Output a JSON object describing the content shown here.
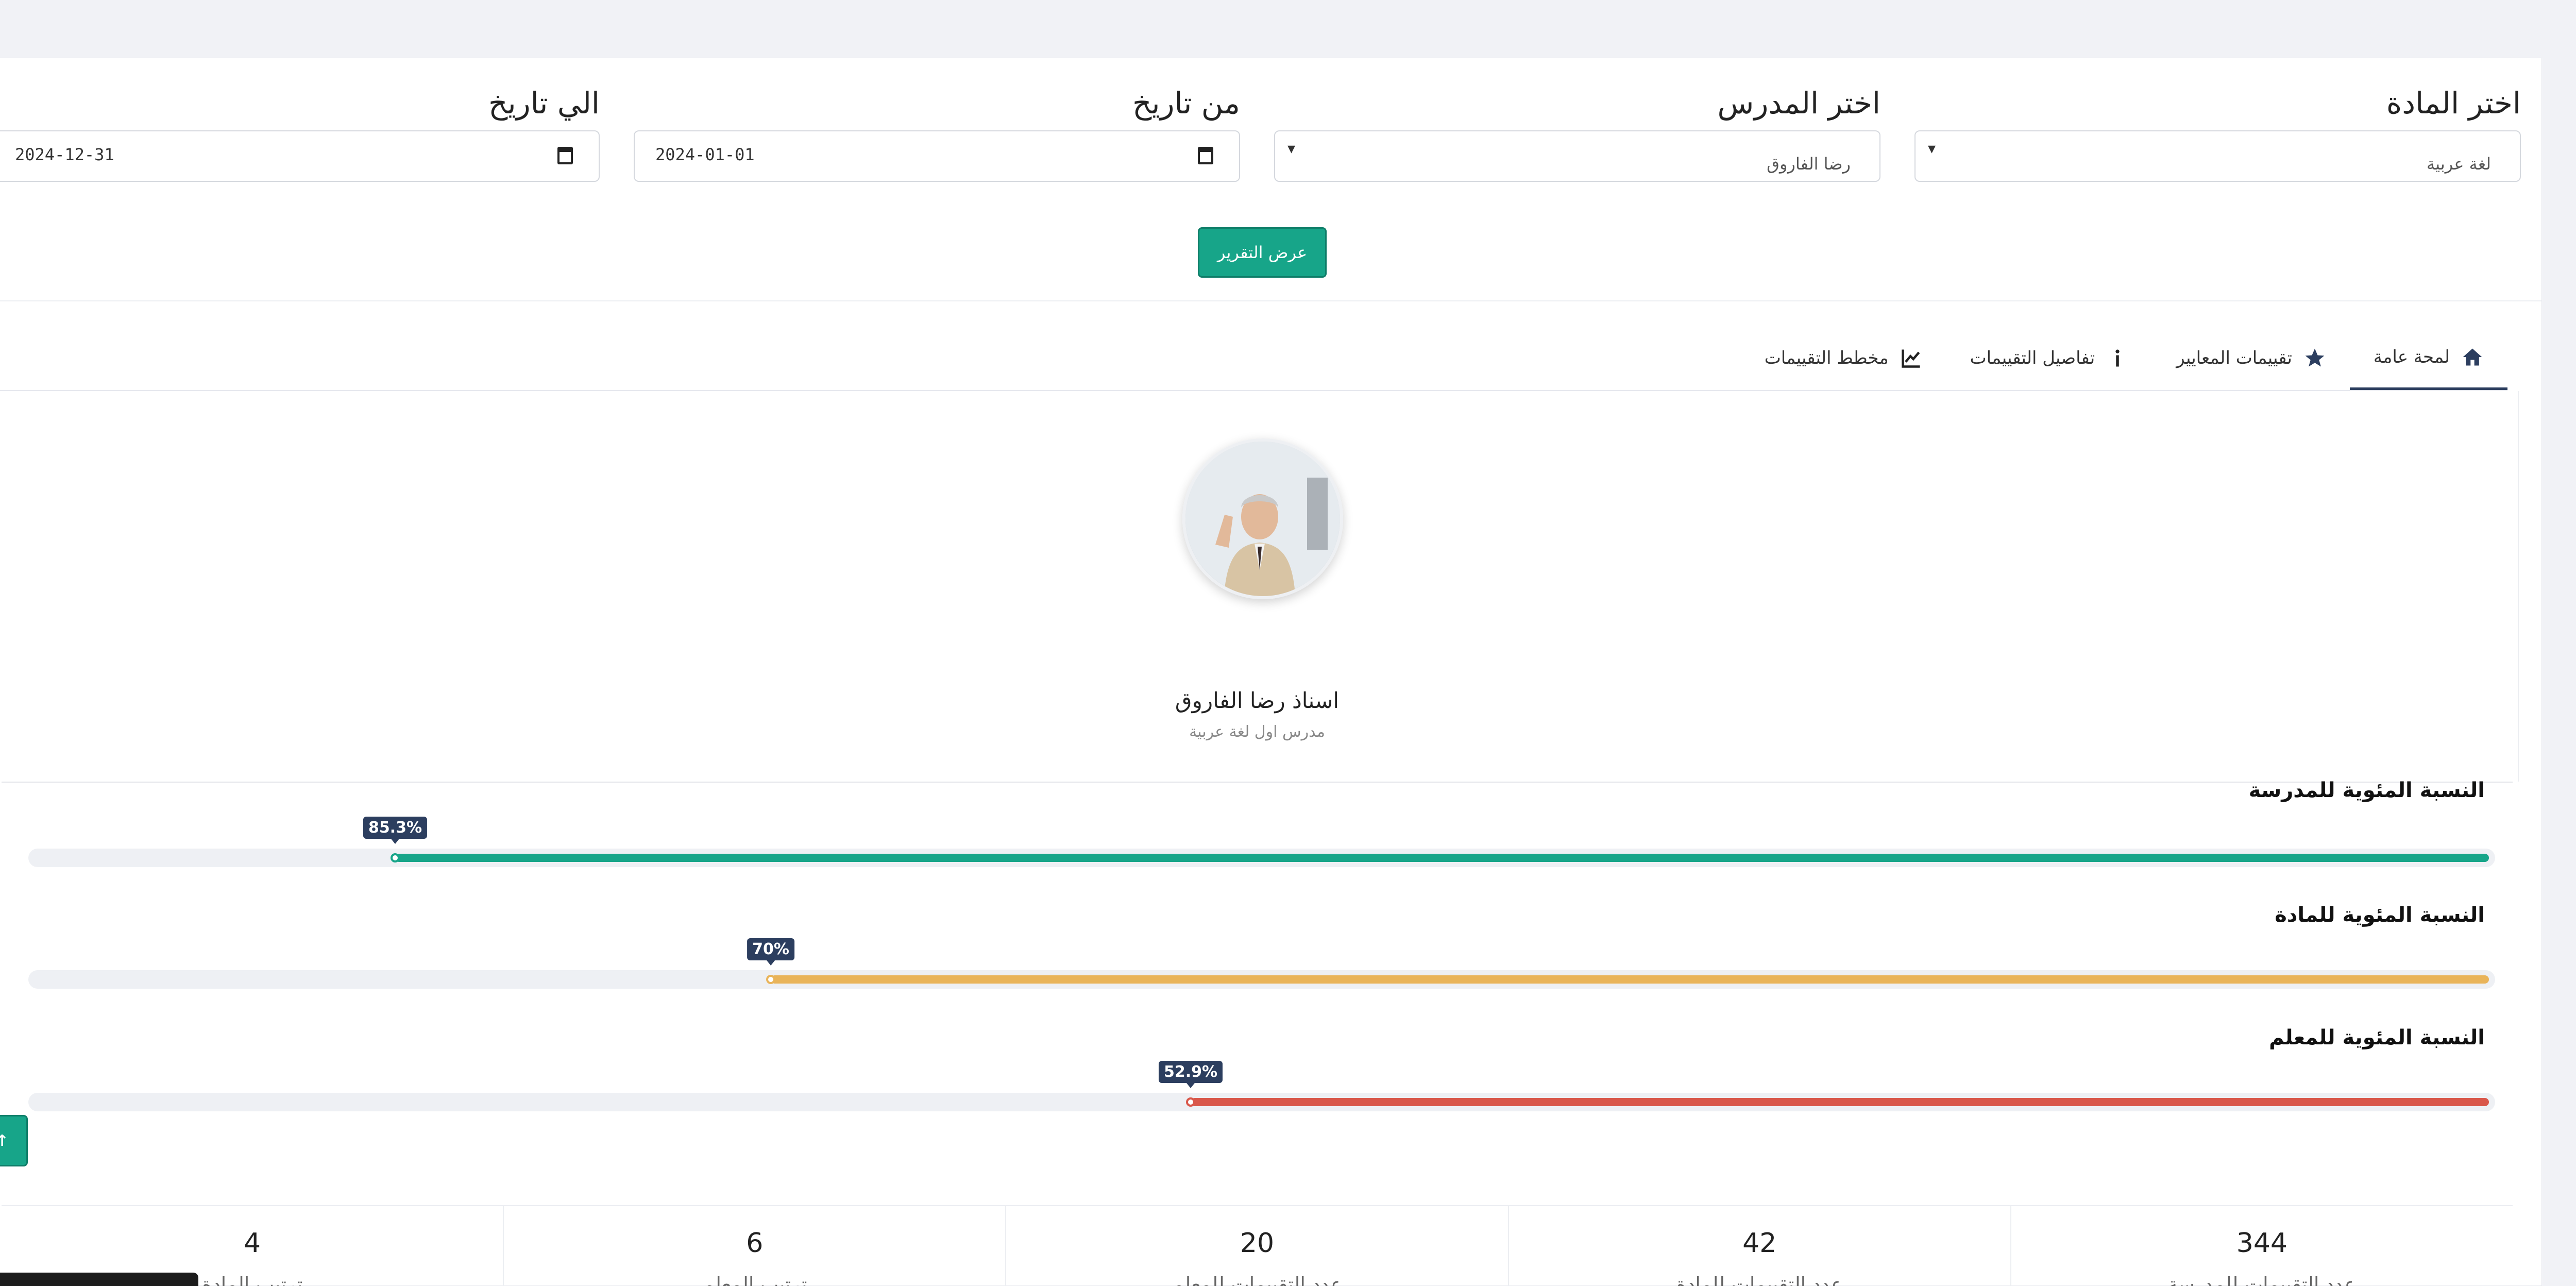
{
  "filters": {
    "subject": {
      "label": "اختر المادة",
      "value": "لغة عربية",
      "caret": "▾"
    },
    "teacher": {
      "label": "اختر المدرس",
      "value": "رضا الفاروق",
      "caret": "▾"
    },
    "from_date": {
      "label": "من تاريخ",
      "value": "2024-01-01"
    },
    "to_date": {
      "label": "الي تاريخ",
      "value": "2024-12-31"
    }
  },
  "submit_label": "عرض التقرير",
  "tabs": [
    {
      "label": "لمحة عامة",
      "icon": "home-icon",
      "active": true
    },
    {
      "label": "تقييمات المعايير",
      "icon": "star-icon",
      "active": false
    },
    {
      "label": "تفاصيل التقييمات",
      "icon": "info-icon",
      "active": false
    },
    {
      "label": "مخطط التقييمات",
      "icon": "chart-icon",
      "active": false
    }
  ],
  "profile": {
    "name": "اسناذ رضا الفاروق",
    "role": "مدرس اول لغة عربية"
  },
  "progress": [
    {
      "title": "النسبة المئوية للمدرسة",
      "value": 85.3,
      "badge": "85.3%",
      "color": "#17a589"
    },
    {
      "title": "النسبة المئوية للمادة",
      "value": 70,
      "badge": "70%",
      "color": "#e9b45a"
    },
    {
      "title": "النسبة المئوية للمعلم",
      "value": 52.9,
      "badge": "52.9%",
      "color": "#d9574a"
    }
  ],
  "stats": [
    {
      "value": "344",
      "label": "عدد التقييمات للمدرسة"
    },
    {
      "value": "42",
      "label": "عدد التقييمات للمادة"
    },
    {
      "value": "20",
      "label": "عدد التقييمات للمعلم"
    },
    {
      "value": "6",
      "label": "ترتيب المعلم"
    },
    {
      "value": "4",
      "label": "ترتيب المادة"
    }
  ],
  "scroll_top_label": "↑"
}
